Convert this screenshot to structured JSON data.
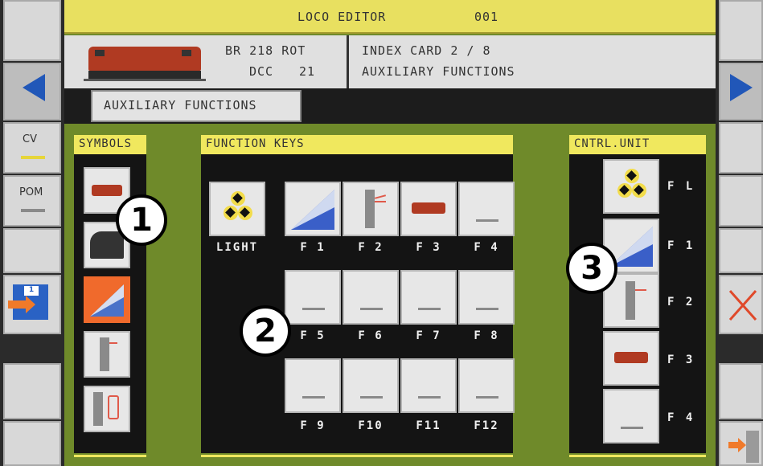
{
  "header": {
    "title": "LOCO EDITOR",
    "number": "001"
  },
  "loco": {
    "name": "BR 218 ROT",
    "protocol": "DCC",
    "address": "21"
  },
  "card": {
    "index": "INDEX CARD 2 / 8",
    "subtitle": "AUXILIARY FUNCTIONS"
  },
  "tab": {
    "label": "AUXILIARY FUNCTIONS"
  },
  "left_sidebar": {
    "cv_label": "CV",
    "pom_label": "POM",
    "save_badge": "1"
  },
  "panels": {
    "symbols": "SYMBOLS",
    "function_keys": "FUNCTION KEYS",
    "control_unit": "CNTRL.UNIT"
  },
  "function_keys": {
    "row1": [
      "LIGHT",
      "F 1",
      "F 2",
      "F 3",
      "F 4"
    ],
    "row2": [
      "F 5",
      "F 6",
      "F 7",
      "F 8"
    ],
    "row3": [
      "F 9",
      "F10",
      "F11",
      "F12"
    ]
  },
  "control_unit": [
    "F L",
    "F 1",
    "F 2",
    "F 3",
    "F 4"
  ],
  "callouts": [
    "1",
    "2",
    "3"
  ],
  "colors": {
    "panel_green": "#6f8a2a",
    "header_yellow": "#e8e060",
    "selected_orange": "#f06a2c",
    "arrow_blue": "#2157b8",
    "close_red": "#e0492a"
  }
}
